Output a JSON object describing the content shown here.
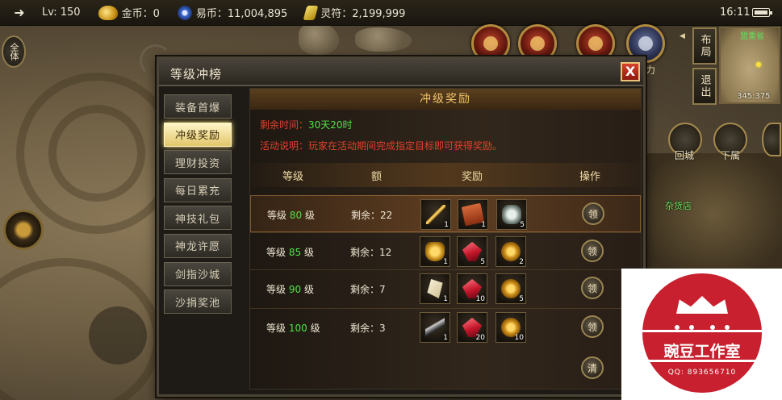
{
  "status_bar": {
    "level": "Lv: 150",
    "gold_label": "金币：0",
    "yibi_label": "易币：11,004,895",
    "lingfu_label": "灵符：2,199,999",
    "time": "16:11"
  },
  "hud": {
    "all_button": "全体",
    "layout_button": "布局",
    "exit_button": "退出",
    "map_name": "盟重省",
    "map_coords": "345:375",
    "return_city": "回城",
    "descend": "下属",
    "shop": "杂货店",
    "power_label": "力"
  },
  "panel": {
    "title": "等级冲榜",
    "close_label": "X",
    "tabs": [
      "装备首爆",
      "冲级奖励",
      "理财投资",
      "每日累充",
      "神技礼包",
      "神龙许愿",
      "剑指沙城",
      "沙捐奖池"
    ],
    "active_tab_index": 1
  },
  "content": {
    "header": "冲级奖励",
    "time_left_key": "剩余时间：",
    "time_left_value": "30天20时",
    "desc_key": "活动说明：",
    "desc_value": "玩家在活动期间完成指定目标即可获得奖励。",
    "columns": {
      "level": "等级",
      "quota": "额",
      "reward": "奖励",
      "action": "操作"
    },
    "rows": [
      {
        "prefix": "等级",
        "level": "80",
        "suffix": "级",
        "remaining": "剩余：22",
        "items": [
          {
            "icon": "sword-icon",
            "count": "1"
          },
          {
            "icon": "book-icon",
            "count": "1"
          },
          {
            "icon": "ore-icon",
            "count": "5"
          }
        ],
        "claim": "领"
      },
      {
        "prefix": "等级",
        "level": "85",
        "suffix": "级",
        "remaining": "剩余：12",
        "items": [
          {
            "icon": "armor-icon",
            "count": "1"
          },
          {
            "icon": "gem-icon",
            "count": "5"
          },
          {
            "icon": "medal-icon",
            "count": "2"
          }
        ],
        "claim": "领"
      },
      {
        "prefix": "等级",
        "level": "90",
        "suffix": "级",
        "remaining": "剩余：7",
        "items": [
          {
            "icon": "wing-icon",
            "count": "1"
          },
          {
            "icon": "gem-icon",
            "count": "10"
          },
          {
            "icon": "medal-icon",
            "count": "5"
          }
        ],
        "claim": "领"
      },
      {
        "prefix": "等级",
        "level": "100",
        "suffix": "级",
        "remaining": "剩余：3",
        "items": [
          {
            "icon": "blade-icon",
            "count": "1"
          },
          {
            "icon": "gem-icon",
            "count": "20"
          },
          {
            "icon": "medal-icon",
            "count": "10"
          }
        ],
        "claim": "领"
      }
    ],
    "clear_label": "清"
  },
  "watermark": {
    "name": "豌豆工作室",
    "qq": "QQ: 893656710"
  }
}
